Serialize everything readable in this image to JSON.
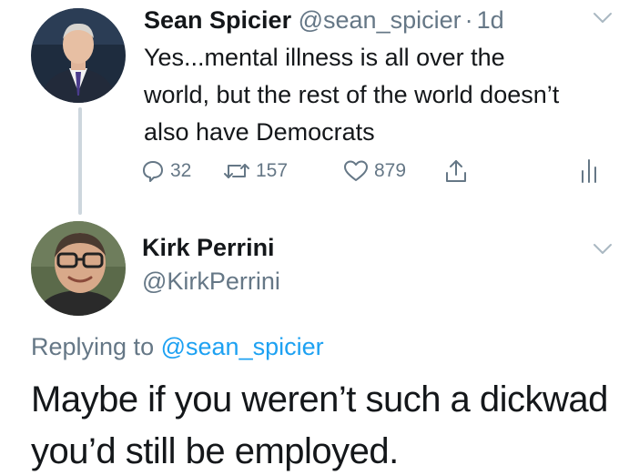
{
  "tweet1": {
    "author_name": "Sean Spicier",
    "author_handle": "@sean_spicier",
    "separator": "·",
    "time": "1d",
    "text": "Yes...mental illness is all over the world, but the rest of the world doesn’t also have Democrats",
    "actions": {
      "reply_icon": "reply-icon",
      "reply_count": "32",
      "retweet_icon": "retweet-icon",
      "retweet_count": "157",
      "like_icon": "heart-icon",
      "like_count": "879",
      "share_icon": "share-icon",
      "analytics_icon": "analytics-icon"
    },
    "menu_icon": "chevron-down-icon"
  },
  "tweet2": {
    "author_name": "Kirk Perrini",
    "author_handle": "@KirkPerrini",
    "replying_prefix": "Replying to",
    "replying_mention": "@sean_spicier",
    "text": "Maybe if you weren’t such a dickwad you’d still be employed.",
    "menu_icon": "chevron-down-icon"
  },
  "colors": {
    "text_primary": "#14171a",
    "text_secondary": "#657786",
    "link": "#1da1f2",
    "icon": "#657786",
    "thread_line": "#cdd6dd"
  }
}
